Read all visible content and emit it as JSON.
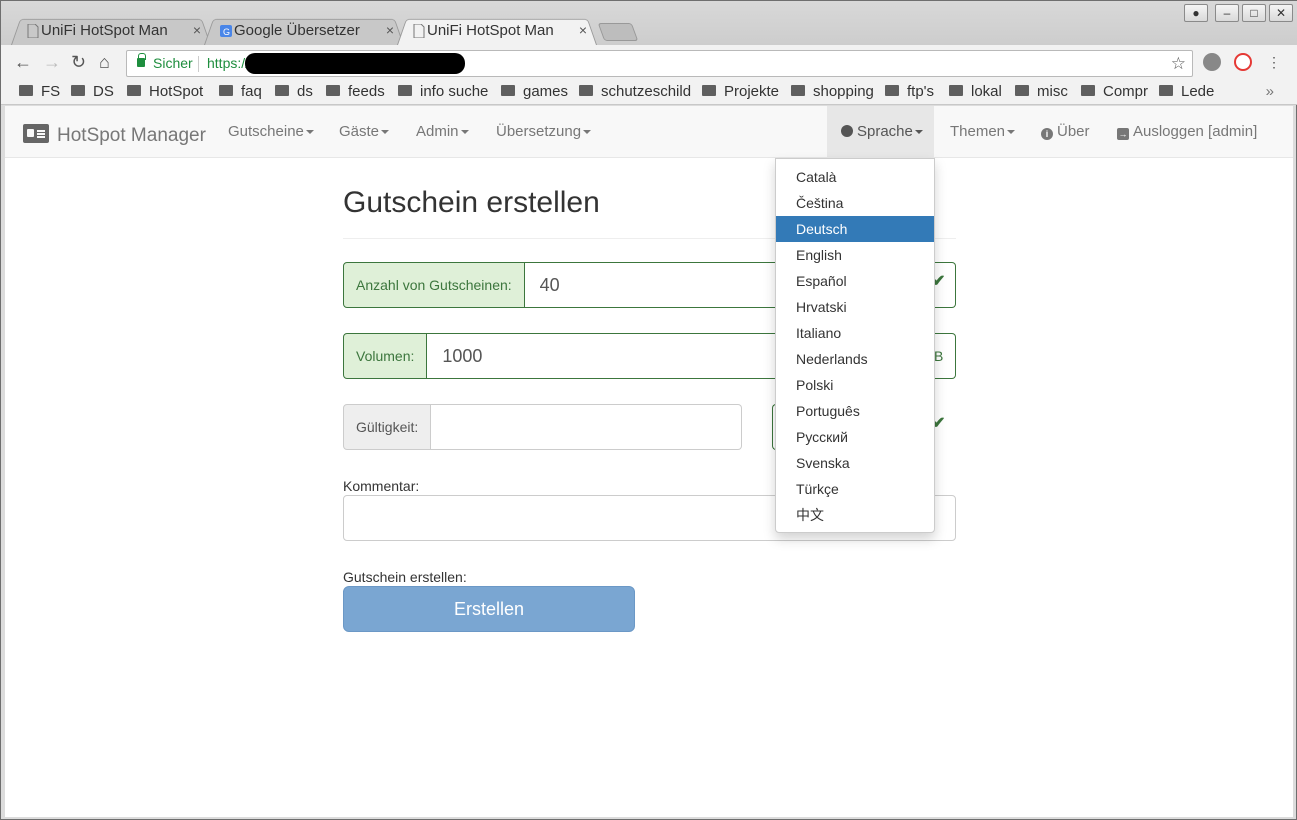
{
  "browser": {
    "tabs": [
      {
        "title": "UniFi HotSpot Mana",
        "active": false
      },
      {
        "title": "Google Übersetzer",
        "active": false
      },
      {
        "title": "UniFi HotSpot Mana",
        "active": true
      }
    ],
    "tab_close": "×",
    "window_controls": [
      "minimize",
      "maximize",
      "close"
    ],
    "address": {
      "security_label": "Sicher",
      "url": "https://"
    },
    "bookmarks": [
      "FS",
      "DS",
      "HotSpot",
      "faq",
      "ds",
      "feeds",
      "info suche",
      "games",
      "schutzeschild",
      "Projekte",
      "shopping",
      "ftp's",
      "lokal",
      "misc",
      "Compr",
      "Lede"
    ],
    "bookmarks_more": "»"
  },
  "navbar": {
    "brand": "HotSpot Manager",
    "menus": [
      "Gutscheine",
      "Gäste",
      "Admin",
      "Übersetzung"
    ],
    "language": "Sprache",
    "themes": "Themen",
    "about": "Über",
    "logout": "Ausloggen [admin]"
  },
  "language_menu": {
    "items": [
      "Català",
      "Čeština",
      "Deutsch",
      "English",
      "Español",
      "Hrvatski",
      "Italiano",
      "Nederlands",
      "Polski",
      "Português",
      "Русский",
      "Svenska",
      "Türkçe",
      "中文"
    ],
    "selected": "Deutsch"
  },
  "form": {
    "title": "Gutschein erstellen",
    "count_label": "Anzahl von Gutscheinen:",
    "count_value": "40",
    "volume_label": "Volumen:",
    "volume_value": "1000",
    "volume_unit_fragment": "B",
    "validity_label": "Gültigkeit:",
    "validity_value": "",
    "comment_label": "Kommentar:",
    "comment_value": "",
    "submit_label": "Gutschein erstellen:",
    "submit_button": "Erstellen"
  },
  "colors": {
    "success": "#3c763d",
    "success_bg": "#dff0d8",
    "primary": "#337ab7",
    "button": "#7aa6d2"
  }
}
